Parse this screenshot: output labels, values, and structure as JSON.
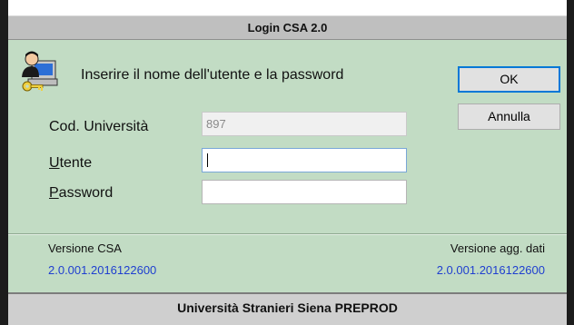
{
  "window": {
    "title": "Login CSA 2.0"
  },
  "prompt": "Inserire il nome dell'utente e la password",
  "buttons": {
    "ok": "OK",
    "cancel": "Annulla"
  },
  "fields": {
    "university": {
      "label": "Cod. Università",
      "value": "897"
    },
    "user": {
      "label_first": "U",
      "label_rest": "tente",
      "value": ""
    },
    "password": {
      "label_first": "P",
      "label_rest": "assword",
      "value": ""
    }
  },
  "versions": {
    "csa": {
      "label": "Versione CSA",
      "value": "2.0.001.2016122600"
    },
    "data": {
      "label": "Versione agg. dati",
      "value": "2.0.001.2016122600"
    }
  },
  "footer": "Università Stranieri Siena PREPROD",
  "icons": [
    "user-computer-key-icon"
  ],
  "colors": {
    "background": "#c2dcc4",
    "version_value": "#1f3fd0"
  }
}
